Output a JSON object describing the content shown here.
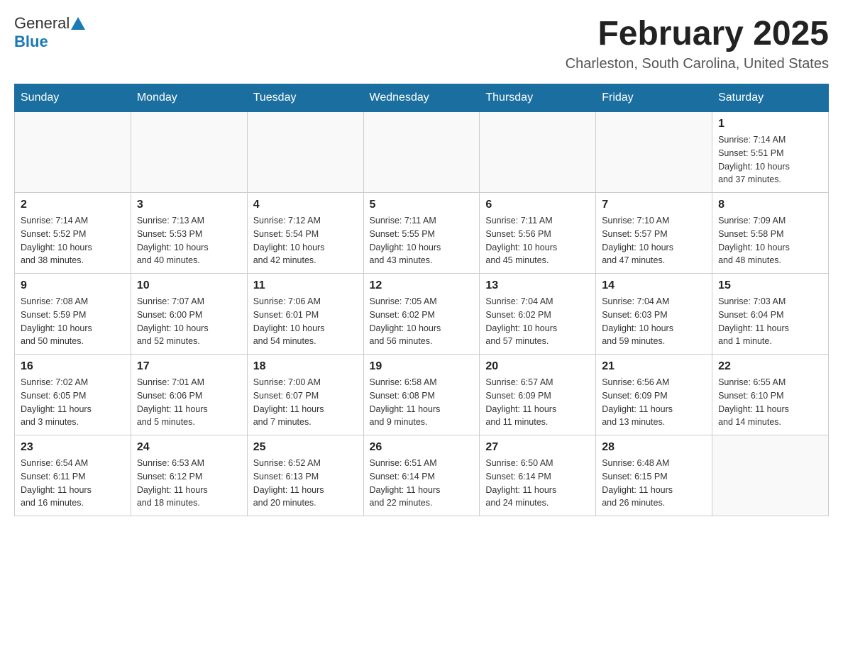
{
  "header": {
    "logo": {
      "general_text": "General",
      "blue_text": "Blue"
    },
    "title": "February 2025",
    "subtitle": "Charleston, South Carolina, United States"
  },
  "calendar": {
    "days_of_week": [
      "Sunday",
      "Monday",
      "Tuesday",
      "Wednesday",
      "Thursday",
      "Friday",
      "Saturday"
    ],
    "weeks": [
      [
        {
          "day": "",
          "info": ""
        },
        {
          "day": "",
          "info": ""
        },
        {
          "day": "",
          "info": ""
        },
        {
          "day": "",
          "info": ""
        },
        {
          "day": "",
          "info": ""
        },
        {
          "day": "",
          "info": ""
        },
        {
          "day": "1",
          "info": "Sunrise: 7:14 AM\nSunset: 5:51 PM\nDaylight: 10 hours\nand 37 minutes."
        }
      ],
      [
        {
          "day": "2",
          "info": "Sunrise: 7:14 AM\nSunset: 5:52 PM\nDaylight: 10 hours\nand 38 minutes."
        },
        {
          "day": "3",
          "info": "Sunrise: 7:13 AM\nSunset: 5:53 PM\nDaylight: 10 hours\nand 40 minutes."
        },
        {
          "day": "4",
          "info": "Sunrise: 7:12 AM\nSunset: 5:54 PM\nDaylight: 10 hours\nand 42 minutes."
        },
        {
          "day": "5",
          "info": "Sunrise: 7:11 AM\nSunset: 5:55 PM\nDaylight: 10 hours\nand 43 minutes."
        },
        {
          "day": "6",
          "info": "Sunrise: 7:11 AM\nSunset: 5:56 PM\nDaylight: 10 hours\nand 45 minutes."
        },
        {
          "day": "7",
          "info": "Sunrise: 7:10 AM\nSunset: 5:57 PM\nDaylight: 10 hours\nand 47 minutes."
        },
        {
          "day": "8",
          "info": "Sunrise: 7:09 AM\nSunset: 5:58 PM\nDaylight: 10 hours\nand 48 minutes."
        }
      ],
      [
        {
          "day": "9",
          "info": "Sunrise: 7:08 AM\nSunset: 5:59 PM\nDaylight: 10 hours\nand 50 minutes."
        },
        {
          "day": "10",
          "info": "Sunrise: 7:07 AM\nSunset: 6:00 PM\nDaylight: 10 hours\nand 52 minutes."
        },
        {
          "day": "11",
          "info": "Sunrise: 7:06 AM\nSunset: 6:01 PM\nDaylight: 10 hours\nand 54 minutes."
        },
        {
          "day": "12",
          "info": "Sunrise: 7:05 AM\nSunset: 6:02 PM\nDaylight: 10 hours\nand 56 minutes."
        },
        {
          "day": "13",
          "info": "Sunrise: 7:04 AM\nSunset: 6:02 PM\nDaylight: 10 hours\nand 57 minutes."
        },
        {
          "day": "14",
          "info": "Sunrise: 7:04 AM\nSunset: 6:03 PM\nDaylight: 10 hours\nand 59 minutes."
        },
        {
          "day": "15",
          "info": "Sunrise: 7:03 AM\nSunset: 6:04 PM\nDaylight: 11 hours\nand 1 minute."
        }
      ],
      [
        {
          "day": "16",
          "info": "Sunrise: 7:02 AM\nSunset: 6:05 PM\nDaylight: 11 hours\nand 3 minutes."
        },
        {
          "day": "17",
          "info": "Sunrise: 7:01 AM\nSunset: 6:06 PM\nDaylight: 11 hours\nand 5 minutes."
        },
        {
          "day": "18",
          "info": "Sunrise: 7:00 AM\nSunset: 6:07 PM\nDaylight: 11 hours\nand 7 minutes."
        },
        {
          "day": "19",
          "info": "Sunrise: 6:58 AM\nSunset: 6:08 PM\nDaylight: 11 hours\nand 9 minutes."
        },
        {
          "day": "20",
          "info": "Sunrise: 6:57 AM\nSunset: 6:09 PM\nDaylight: 11 hours\nand 11 minutes."
        },
        {
          "day": "21",
          "info": "Sunrise: 6:56 AM\nSunset: 6:09 PM\nDaylight: 11 hours\nand 13 minutes."
        },
        {
          "day": "22",
          "info": "Sunrise: 6:55 AM\nSunset: 6:10 PM\nDaylight: 11 hours\nand 14 minutes."
        }
      ],
      [
        {
          "day": "23",
          "info": "Sunrise: 6:54 AM\nSunset: 6:11 PM\nDaylight: 11 hours\nand 16 minutes."
        },
        {
          "day": "24",
          "info": "Sunrise: 6:53 AM\nSunset: 6:12 PM\nDaylight: 11 hours\nand 18 minutes."
        },
        {
          "day": "25",
          "info": "Sunrise: 6:52 AM\nSunset: 6:13 PM\nDaylight: 11 hours\nand 20 minutes."
        },
        {
          "day": "26",
          "info": "Sunrise: 6:51 AM\nSunset: 6:14 PM\nDaylight: 11 hours\nand 22 minutes."
        },
        {
          "day": "27",
          "info": "Sunrise: 6:50 AM\nSunset: 6:14 PM\nDaylight: 11 hours\nand 24 minutes."
        },
        {
          "day": "28",
          "info": "Sunrise: 6:48 AM\nSunset: 6:15 PM\nDaylight: 11 hours\nand 26 minutes."
        },
        {
          "day": "",
          "info": ""
        }
      ]
    ]
  }
}
